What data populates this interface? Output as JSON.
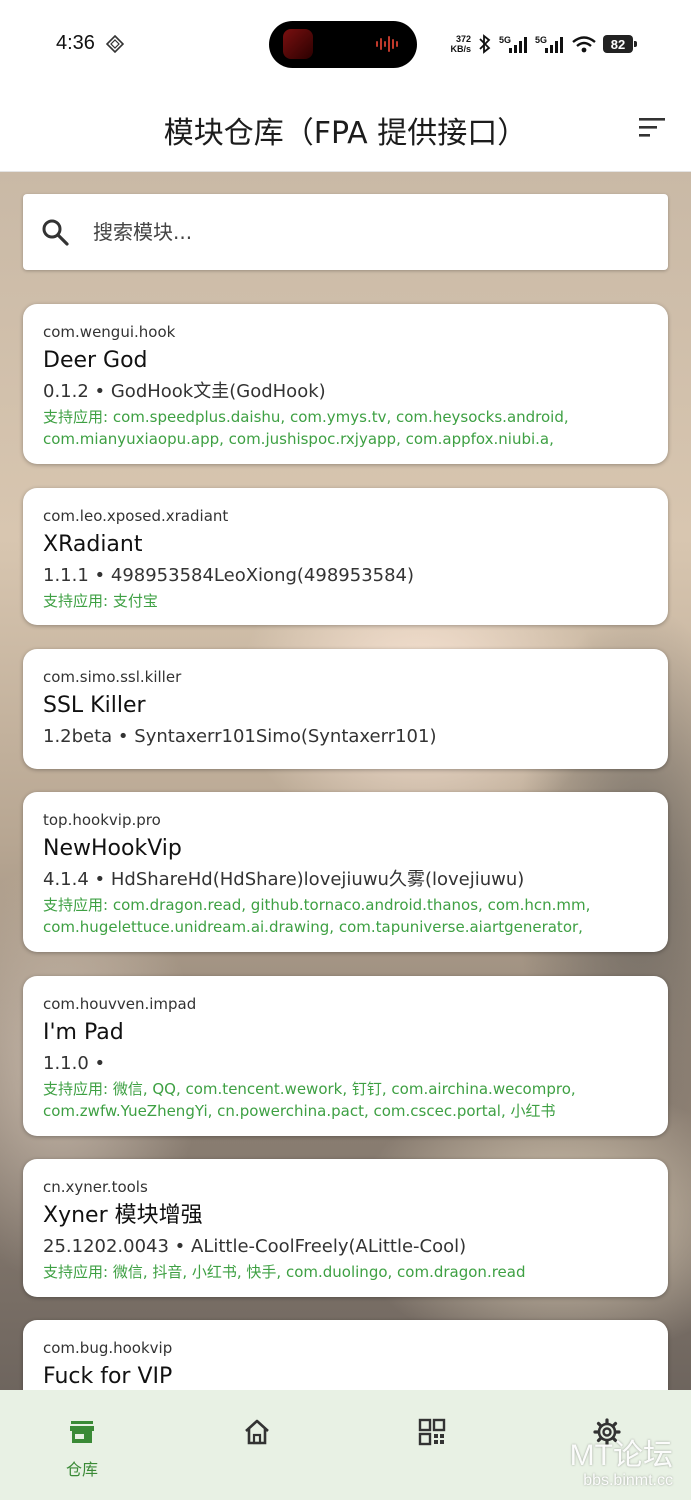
{
  "status_bar": {
    "time": "4:36",
    "net_speed_value": "372",
    "net_speed_unit": "KB/s",
    "signal_label_1": "5G",
    "signal_label_2": "5G",
    "battery": "82"
  },
  "app_bar": {
    "title": "模块仓库（FPA 提供接口）",
    "sort_icon": "sort-icon"
  },
  "search": {
    "placeholder": "搜索模块..."
  },
  "modules": [
    {
      "package": "com.wengui.hook",
      "name": "Deer God",
      "meta": "0.1.2  •  GodHook文圭(GodHook)",
      "apps": "支持应用: com.speedplus.daishu, com.ymys.tv, com.heysocks.android, com.mianyuxiaopu.app, com.jushispoc.rxjyapp, com.appfox.niubi.a,"
    },
    {
      "package": "com.leo.xposed.xradiant",
      "name": "XRadiant",
      "meta": "1.1.1  •  498953584LeoXiong(498953584)",
      "apps": "支持应用: 支付宝"
    },
    {
      "package": "com.simo.ssl.killer",
      "name": "SSL Killer",
      "meta": "1.2beta  •  Syntaxerr101Simo(Syntaxerr101)",
      "apps": ""
    },
    {
      "package": "top.hookvip.pro",
      "name": "NewHookVip",
      "meta": "4.1.4  •  HdShareHd(HdShare)lovejiuwu久雾(lovejiuwu)",
      "apps": "支持应用: com.dragon.read, github.tornaco.android.thanos, com.hcn.mm, com.hugelettuce.unidream.ai.drawing, com.tapuniverse.aiartgenerator,"
    },
    {
      "package": "com.houvven.impad",
      "name": "I'm Pad",
      "meta": "1.1.0  •",
      "apps": "支持应用: 微信, QQ, com.tencent.wework, 钉钉, com.airchina.wecompro, com.zwfw.YueZhengYi, cn.powerchina.pact, com.cscec.portal, 小红书"
    },
    {
      "package": "cn.xyner.tools",
      "name": "Xyner 模块增强",
      "meta": "25.1202.0043  •  ALittle-CoolFreely(ALittle-Cool)",
      "apps": "支持应用: 微信, 抖音, 小红书, 快手, com.duolingo, com.dragon.read"
    },
    {
      "package": "com.bug.hookvip",
      "name": "Fuck for VIP",
      "meta": "",
      "apps": ""
    }
  ],
  "bottom_nav": {
    "items": [
      {
        "label": "仓库",
        "icon": "store-icon",
        "active": true
      },
      {
        "label": "",
        "icon": "home-icon",
        "active": false
      },
      {
        "label": "",
        "icon": "grid-icon",
        "active": false
      },
      {
        "label": "",
        "icon": "gear-icon",
        "active": false
      }
    ]
  },
  "watermark": {
    "line1": "MT论坛",
    "line2": "bbs.binmt.cc"
  },
  "colors": {
    "accent_green": "#3ea043",
    "nav_background": "#e8f1e4"
  }
}
